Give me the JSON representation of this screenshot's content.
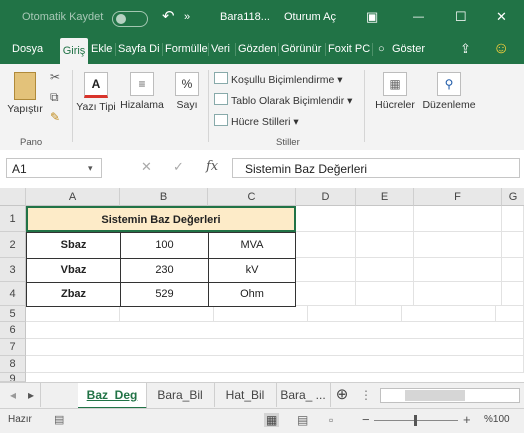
{
  "titlebar": {
    "autosave_label": "Otomatik Kaydet",
    "doc_title": "Bara118...",
    "sign_in": "Oturum Aç",
    "undo_glyph": "↶",
    "more_glyph": "»",
    "ribbon_display_glyph": "▣",
    "minimize_glyph": "—",
    "maximize_glyph": "☐",
    "close_glyph": "✕"
  },
  "tabs": {
    "items": [
      "Dosya",
      "Giriş",
      "Ekle",
      "Sayfa Di",
      "Formülle",
      "Veri",
      "Gözden",
      "Görünür",
      "Foxit PC"
    ],
    "active": "Giriş",
    "tell_me": "Göster",
    "share_glyph": "⇪",
    "smiley_glyph": "☺"
  },
  "ribbon": {
    "paste": "Yapıştır",
    "font": "Yazı Tipi",
    "align": "Hizalama",
    "number": "Sayı",
    "styles": [
      "Koşullu Biçimlendirme",
      "Tablo Olarak Biçimlendir",
      "Hücre Stilleri"
    ],
    "cells": "Hücreler",
    "editing": "Düzenleme",
    "group_clipboard": "Pano",
    "group_styles": "Stiller",
    "font_icon": "A",
    "number_icon": "%"
  },
  "formula": {
    "name_box": "A1",
    "cancel_glyph": "✕",
    "enter_glyph": "✓",
    "fx_glyph": "fx",
    "value": "Sistemin Baz Değerleri"
  },
  "grid": {
    "columns": [
      "A",
      "B",
      "C",
      "D",
      "E",
      "F",
      "G"
    ],
    "rows": [
      "1",
      "2",
      "3",
      "4",
      "5",
      "6",
      "7",
      "8",
      "9"
    ],
    "title": "Sistemin Baz Değerleri",
    "table": [
      {
        "label": "Sbaz",
        "value": "100",
        "unit": "MVA"
      },
      {
        "label": "Vbaz",
        "value": "230",
        "unit": "kV"
      },
      {
        "label": "Zbaz",
        "value": "529",
        "unit": "Ohm"
      }
    ]
  },
  "sheets": {
    "tabs": [
      "Baz_Deg",
      "Bara_Bil",
      "Hat_Bil",
      "Bara_ ..."
    ],
    "active": "Baz_Deg",
    "add_glyph": "⊕"
  },
  "status": {
    "ready": "Hazır",
    "zoom": "%100"
  },
  "colors": {
    "accent": "#217346",
    "title_fill": "#fdebc8"
  }
}
